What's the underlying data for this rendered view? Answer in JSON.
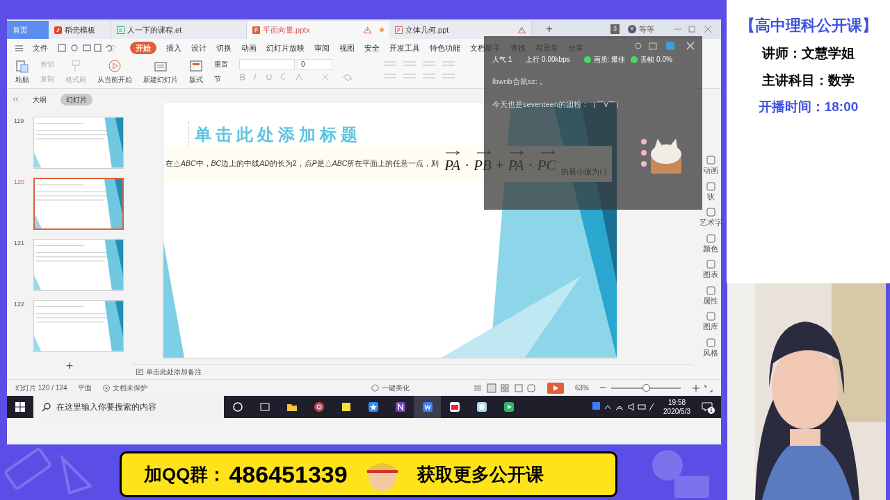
{
  "doc_tabs": [
    {
      "label": "首页",
      "kind": "home",
      "selected": false
    },
    {
      "label": "稻壳模板",
      "kind": "docer",
      "selected": false
    },
    {
      "label": "人一下的课程.et",
      "kind": "sheet",
      "selected": false
    },
    {
      "label": "平面向量.pptx",
      "kind": "slides",
      "selected": true,
      "warning": true,
      "unsaved": true
    },
    {
      "label": "立体几何.ppt",
      "kind": "slides",
      "selected": false,
      "warning": true
    }
  ],
  "new_tab": "+",
  "tab_count": "3",
  "user": "等等",
  "menu": [
    {
      "label": "文件",
      "selected": false
    },
    {
      "label": "开始",
      "selected": true
    },
    {
      "label": "插入",
      "selected": false
    },
    {
      "label": "设计",
      "selected": false
    },
    {
      "label": "切换",
      "selected": false
    },
    {
      "label": "动画",
      "selected": false
    },
    {
      "label": "幻灯片放映",
      "selected": false
    },
    {
      "label": "审阅",
      "selected": false
    },
    {
      "label": "视图",
      "selected": false
    },
    {
      "label": "安全",
      "selected": false
    },
    {
      "label": "开发工具",
      "selected": false
    },
    {
      "label": "特色功能",
      "selected": false
    },
    {
      "label": "文档助手",
      "selected": false
    },
    {
      "label": "查找",
      "selected": false
    },
    {
      "label": "有异常",
      "selected": false
    },
    {
      "label": "分享",
      "selected": false
    }
  ],
  "ribbon": {
    "paste": "粘贴",
    "cut": "剪切",
    "copy": "复制",
    "format_painter": "格式刷",
    "play_from_current": "从当前开始",
    "new_slide": "新建幻灯片",
    "layout": "版式",
    "reset": "重置",
    "section": "节",
    "font_size": "0"
  },
  "outline_tabs": [
    {
      "label": "大纲",
      "selected": false
    },
    {
      "label": "幻灯片",
      "selected": true
    }
  ],
  "thumbnails": [
    {
      "number": "119",
      "selected": false
    },
    {
      "number": "120",
      "selected": true
    },
    {
      "number": "121",
      "selected": false
    },
    {
      "number": "122",
      "selected": false
    }
  ],
  "add_slide": "+",
  "slide": {
    "title_placeholder": "单击此处添加标题",
    "question": [
      {
        "text": "在△",
        "italic": false
      },
      {
        "text": "ABC",
        "italic": true
      },
      {
        "text": "中，",
        "italic": false
      },
      {
        "text": "BC",
        "italic": true
      },
      {
        "text": "边上的中线",
        "italic": false
      },
      {
        "text": "AD",
        "italic": true
      },
      {
        "text": "的长为2，点",
        "italic": false
      },
      {
        "text": "P",
        "italic": true
      },
      {
        "text": "是△",
        "italic": false
      },
      {
        "text": "ABC",
        "italic": true
      },
      {
        "text": "所在平面上的任意一点，则",
        "italic": false
      }
    ],
    "formula": [
      {
        "kind": "vector",
        "text": "PA"
      },
      {
        "kind": "op",
        "text": "·"
      },
      {
        "kind": "vector",
        "text": "PB"
      },
      {
        "kind": "op",
        "text": "+"
      },
      {
        "kind": "vector",
        "text": "PA"
      },
      {
        "kind": "op",
        "text": "·"
      },
      {
        "kind": "vector",
        "text": "PC"
      }
    ],
    "question_end": "的最小值为( )"
  },
  "notes_placeholder": "单击此处添加备注",
  "side_tools": [
    "动画",
    "状",
    "艺术字",
    "颜色",
    "图表",
    "属性",
    "图库",
    "风格"
  ],
  "status_bar": {
    "slide_count": "幻灯片 120 / 124",
    "theme": "平面",
    "protection": "文档未保护",
    "beautify": "一键美化",
    "zoom": "63%",
    "zoom_slider": {
      "level": 0.5
    }
  },
  "taskbar": {
    "search_placeholder": "在这里输入你要搜索的内容",
    "time": "19:58",
    "date": "2020/5/3",
    "notification_count": "1"
  },
  "live_panel": {
    "popularity": "人气 1",
    "upload": "上行 0.00kbps",
    "quality": "画质: 最佳",
    "frame_drop": "丢帧 0.0%",
    "messages": [
      "lbwnb合鼠sz: 。",
      "今天也是seventeen的团粉：（￣v￣）"
    ]
  },
  "course_info": {
    "title": "【高中理科公开课】",
    "teacher": "讲师：文慧学姐",
    "subject": "主讲科目：数学",
    "start_time": "开播时间：18:00"
  },
  "banner": {
    "group_label": "加QQ群：",
    "group_number": "486451339",
    "slogan": "获取更多公开课"
  }
}
